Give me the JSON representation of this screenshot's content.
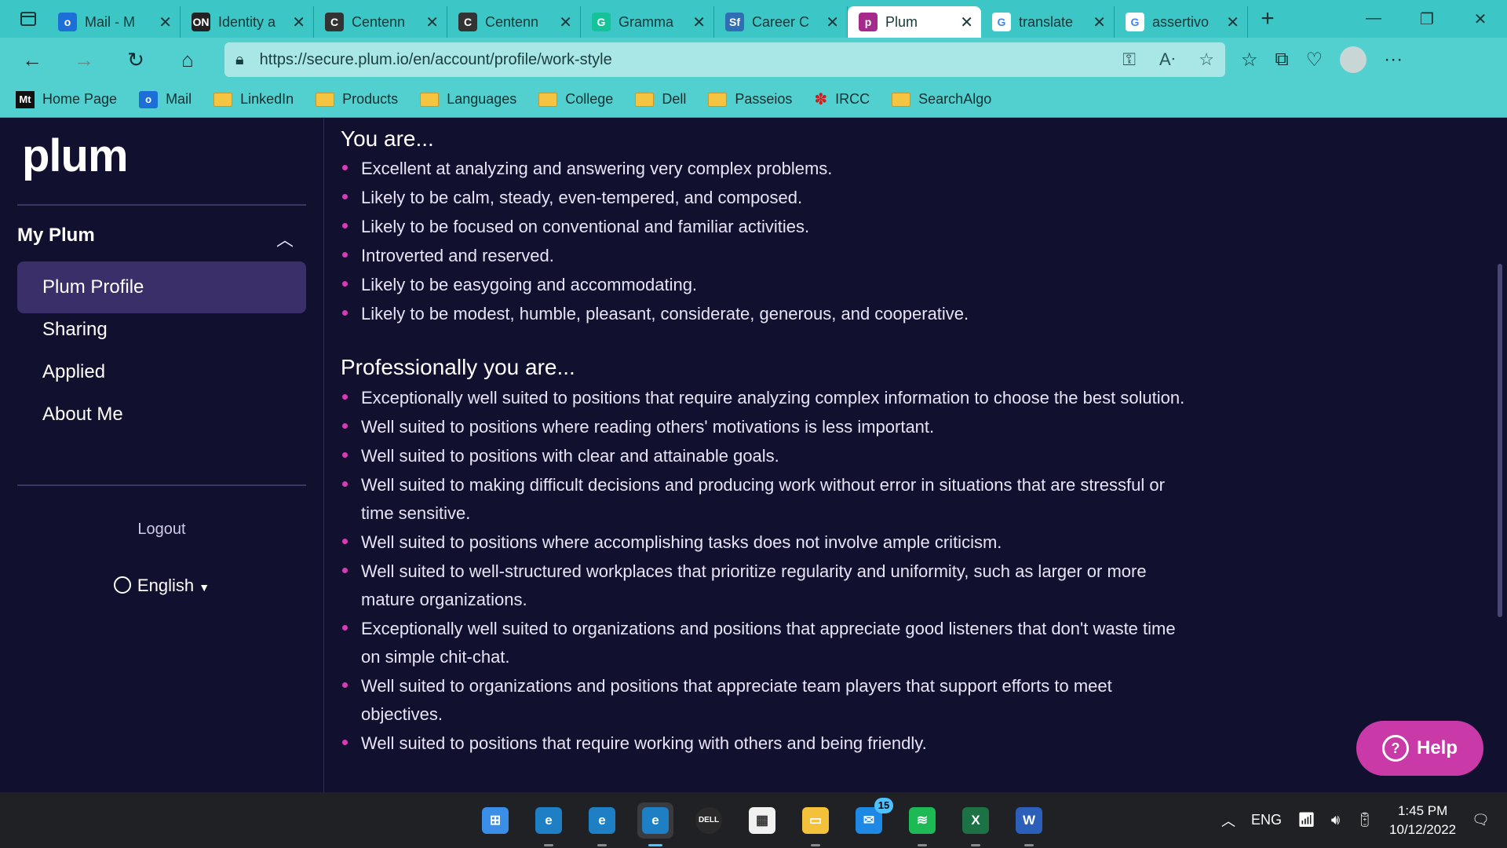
{
  "browser": {
    "tabs": [
      {
        "title": "Mail - M",
        "favicon": "outlook",
        "active": false
      },
      {
        "title": "Identity a",
        "favicon": "on-ed",
        "active": false
      },
      {
        "title": "Centenn",
        "favicon": "c",
        "active": false
      },
      {
        "title": "Centenn",
        "favicon": "c",
        "active": false
      },
      {
        "title": "Gramma",
        "favicon": "grammarly",
        "active": false
      },
      {
        "title": "Career C",
        "favicon": "sf",
        "active": false
      },
      {
        "title": "Plum",
        "favicon": "plum",
        "active": true
      },
      {
        "title": "translate",
        "favicon": "google",
        "active": false
      },
      {
        "title": "assertivo",
        "favicon": "google",
        "active": false
      }
    ],
    "url": "https://secure.plum.io/en/account/profile/work-style",
    "favorites": [
      {
        "label": "Home Page",
        "icon": "mt"
      },
      {
        "label": "Mail",
        "icon": "outlook"
      },
      {
        "label": "LinkedIn",
        "icon": "folder"
      },
      {
        "label": "Products",
        "icon": "folder"
      },
      {
        "label": "Languages",
        "icon": "folder"
      },
      {
        "label": "College",
        "icon": "folder"
      },
      {
        "label": "Dell",
        "icon": "folder"
      },
      {
        "label": "Passeios",
        "icon": "folder"
      },
      {
        "label": "IRCC",
        "icon": "maple-leaf"
      },
      {
        "label": "SearchAlgo",
        "icon": "folder"
      }
    ],
    "colors": {
      "chrome": "#3dc6c6",
      "toolbar": "#52d0d0"
    }
  },
  "sidebar": {
    "logo": "plum",
    "section_title": "My Plum",
    "items": [
      {
        "label": "Plum Profile",
        "active": true
      },
      {
        "label": "Sharing",
        "active": false
      },
      {
        "label": "Applied",
        "active": false
      },
      {
        "label": "About Me",
        "active": false
      }
    ],
    "logout": "Logout",
    "language": "English"
  },
  "main": {
    "you_are": {
      "heading": "You are...",
      "items": [
        "Excellent at analyzing and answering very complex problems.",
        "Likely to be calm, steady, even-tempered, and composed.",
        "Likely to be focused on conventional and familiar activities.",
        "Introverted and reserved.",
        "Likely to be easygoing and accommodating.",
        "Likely to be modest, humble, pleasant, considerate, generous, and cooperative."
      ]
    },
    "professionally": {
      "heading": "Professionally you are...",
      "items": [
        "Exceptionally well suited to positions that require analyzing complex information to choose the best solution.",
        "Well suited to positions where reading others' motivations is less important.",
        "Well suited to positions with clear and attainable goals.",
        "Well suited to making difficult decisions and producing work without error in situations that are stressful or time sensitive.",
        "Well suited to positions where accomplishing tasks does not involve ample criticism.",
        "Well suited to well-structured workplaces that prioritize regularity and uniformity, such as larger or more mature organizations.",
        "Exceptionally well suited to organizations and positions that appreciate good listeners that don't waste time on simple chit-chat.",
        "Well suited to organizations and positions that appreciate team players that support efforts to meet objectives.",
        "Well suited to positions that require working with others and being friendly."
      ]
    },
    "colors": {
      "background": "#12102f",
      "bullet": "#d93bb6",
      "active_nav": "#3a2f68"
    }
  },
  "help_button": {
    "label": "Help",
    "color": "#c93aa8"
  },
  "taskbar": {
    "apps": [
      "start",
      "edge-profile-1",
      "edge-profile-2",
      "edge-active",
      "dell",
      "microsoft-store",
      "file-explorer",
      "mail",
      "spotify",
      "excel",
      "word"
    ],
    "mail_badge": "15",
    "language": "ENG",
    "time": "1:45 PM",
    "date": "10/12/2022"
  }
}
